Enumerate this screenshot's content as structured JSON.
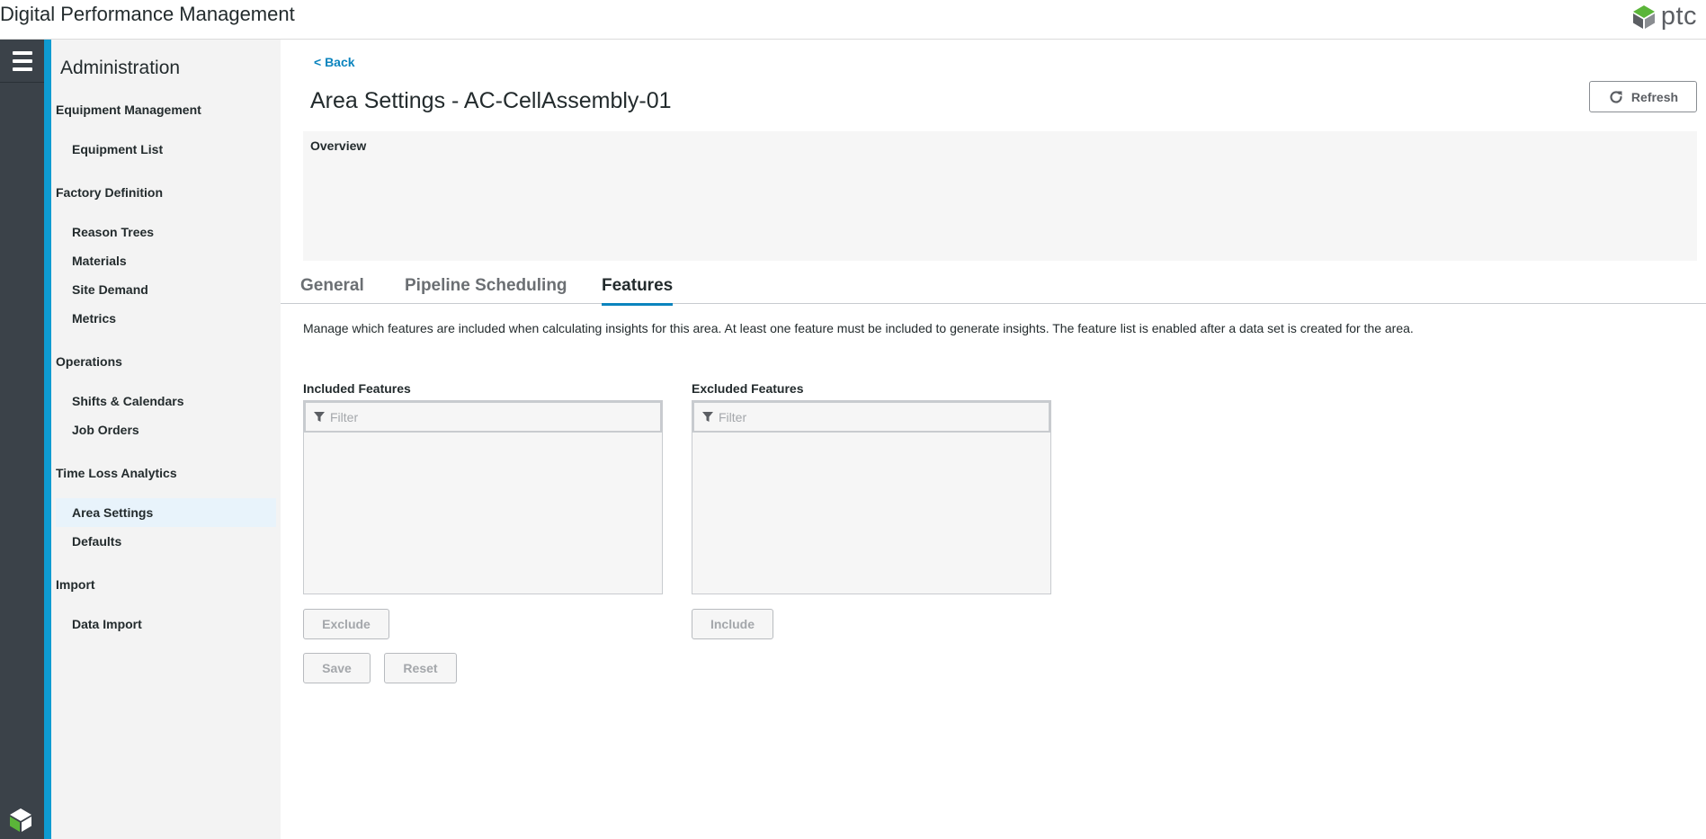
{
  "header": {
    "app_title": "Digital Performance Management",
    "brand": "ptc",
    "brand_color": "#5bb539"
  },
  "rail": {
    "menu_icon": "hamburger-menu-icon",
    "bottom_icon": "thingworx-logo-icon",
    "accent_color": "#0e9bd1"
  },
  "sidebar": {
    "title": "Administration",
    "sections": [
      {
        "label": "Equipment Management",
        "items": [
          "Equipment List"
        ]
      },
      {
        "label": "Factory Definition",
        "items": [
          "Reason Trees",
          "Materials",
          "Site Demand",
          "Metrics"
        ]
      },
      {
        "label": "Operations",
        "items": [
          "Shifts & Calendars",
          "Job Orders"
        ]
      },
      {
        "label": "Time Loss Analytics",
        "items": [
          "Area Settings",
          "Defaults"
        ]
      },
      {
        "label": "Import",
        "items": [
          "Data Import"
        ]
      }
    ],
    "active_item": "Area Settings"
  },
  "main": {
    "back_label": "< Back",
    "page_title": "Area Settings - AC-CellAssembly-01",
    "refresh_label": "Refresh",
    "overview_label": "Overview",
    "tabs": [
      {
        "label": "General",
        "active": false
      },
      {
        "label": "Pipeline Scheduling",
        "active": false
      },
      {
        "label": "Features",
        "active": true
      }
    ],
    "description": "Manage which features are included when calculating insights for this area. At least one feature must be included to generate insights. The feature list is enabled after a data set is created for the area.",
    "included": {
      "label": "Included Features",
      "filter_placeholder": "Filter",
      "button_label": "Exclude"
    },
    "excluded": {
      "label": "Excluded Features",
      "filter_placeholder": "Filter",
      "button_label": "Include"
    },
    "save_label": "Save",
    "reset_label": "Reset"
  }
}
